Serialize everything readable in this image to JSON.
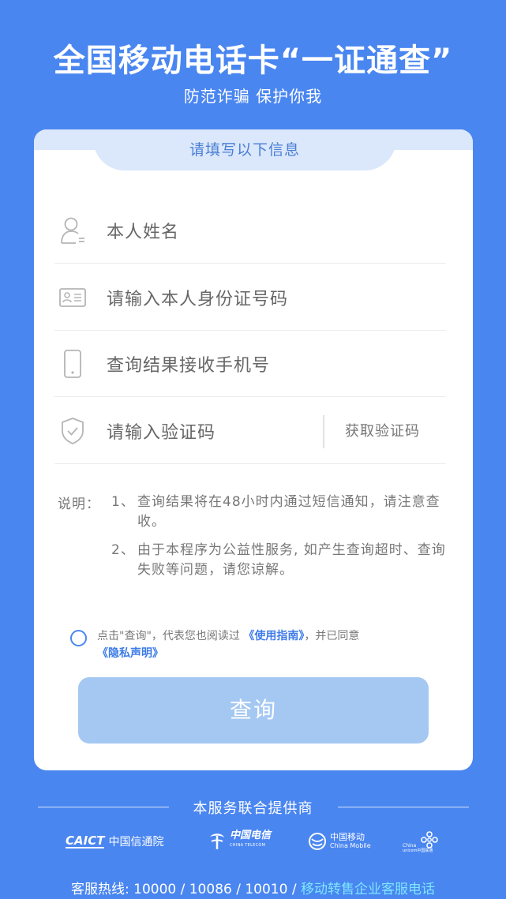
{
  "header": {
    "title": "全国移动电话卡“一证通查”",
    "subtitle": "防范诈骗 保护你我"
  },
  "form": {
    "tab_title": "请填写以下信息",
    "fields": [
      {
        "icon": "person-icon",
        "placeholder": "本人姓名"
      },
      {
        "icon": "id-card-icon",
        "placeholder": "请输入本人身份证号码"
      },
      {
        "icon": "phone-icon",
        "placeholder": "查询结果接收手机号"
      },
      {
        "icon": "shield-icon",
        "placeholder": "请输入验证码"
      }
    ],
    "get_code_label": "获取验证码"
  },
  "notes": {
    "label": "说明：",
    "items": [
      {
        "num": "1、",
        "text": "查询结果将在48小时内通过短信通知，请注意查收。"
      },
      {
        "num": "2、",
        "text": "由于本程序为公益性服务, 如产生查询超时、查询失败等问题，请您谅解。"
      }
    ]
  },
  "agreement": {
    "prefix": "点击\"查询\"，代表您也阅读过",
    "guide_link": "《使用指南》",
    "middle": "，并已同意",
    "privacy_link": "《隐私声明》",
    "checked": false
  },
  "query_button": "查询",
  "providers": {
    "title": "本服务联合提供商",
    "logos": [
      {
        "name": "caict",
        "mark": "CAICT",
        "text": "中国信通院"
      },
      {
        "name": "china-telecom",
        "mark": "中国电信",
        "text": "CHINA TELECOM"
      },
      {
        "name": "china-mobile",
        "mark": "中国移动",
        "text": "China Mobile"
      },
      {
        "name": "china-unicom",
        "mark": "China",
        "text": "unicom中国联通"
      }
    ]
  },
  "hotline": {
    "prefix": "客服热线: 10000 / 10086 / 10010 / ",
    "highlight": "移动转售企业客服电话"
  },
  "colors": {
    "background": "#4a86f0",
    "button_disabled": "#a5c8f3",
    "link": "#3d7be8"
  }
}
